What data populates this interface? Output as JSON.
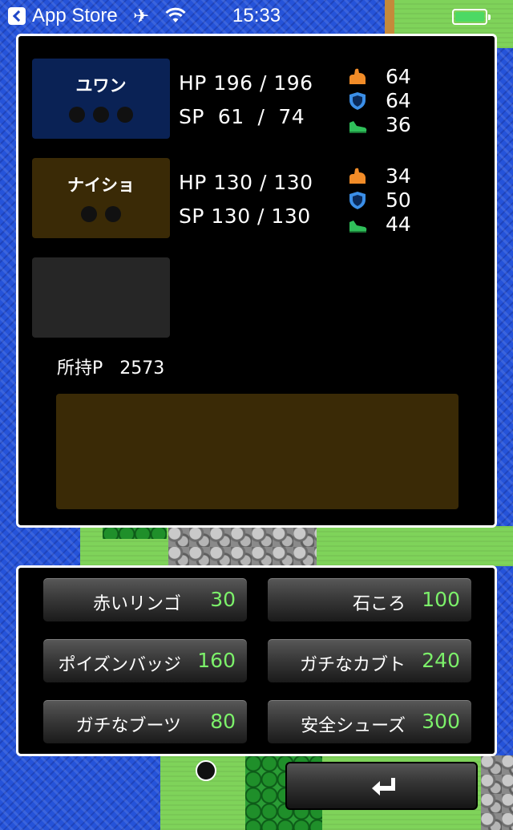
{
  "status_bar": {
    "back_label": "App Store",
    "time": "15:33",
    "icons": [
      "back-chevron-icon",
      "airplane-icon",
      "wifi-icon",
      "battery-icon"
    ]
  },
  "party": [
    {
      "name": "ユワン",
      "color": "#0a2255",
      "dot_count": 3,
      "hp_line": "HP 196 / 196",
      "sp_line": "SP  61  /  74",
      "attack": "64",
      "defense": "64",
      "speed": "36"
    },
    {
      "name": "ナイショ",
      "color": "#3a2a06",
      "dot_count": 2,
      "hp_line": "HP 130 / 130",
      "sp_line": "SP 130 / 130",
      "attack": "34",
      "defense": "50",
      "speed": "44"
    }
  ],
  "stat_icons": [
    "attack-arm-icon",
    "defense-shield-icon",
    "speed-shoe-icon"
  ],
  "points_text": "所持P   2573",
  "shop": {
    "items": [
      {
        "name": "赤いリンゴ",
        "price": "30"
      },
      {
        "name": "石ころ",
        "price": "100"
      },
      {
        "name": "ポイズンバッジ",
        "price": "160"
      },
      {
        "name": "ガチなカブト",
        "price": "240"
      },
      {
        "name": "ガチなブーツ",
        "price": "80"
      },
      {
        "name": "安全シューズ",
        "price": "300"
      }
    ]
  },
  "colors": {
    "price": "#7cf06a",
    "attack_icon": "#f28c28",
    "defense_icon": "#3b8fe8",
    "speed_icon": "#2fbf5a"
  }
}
